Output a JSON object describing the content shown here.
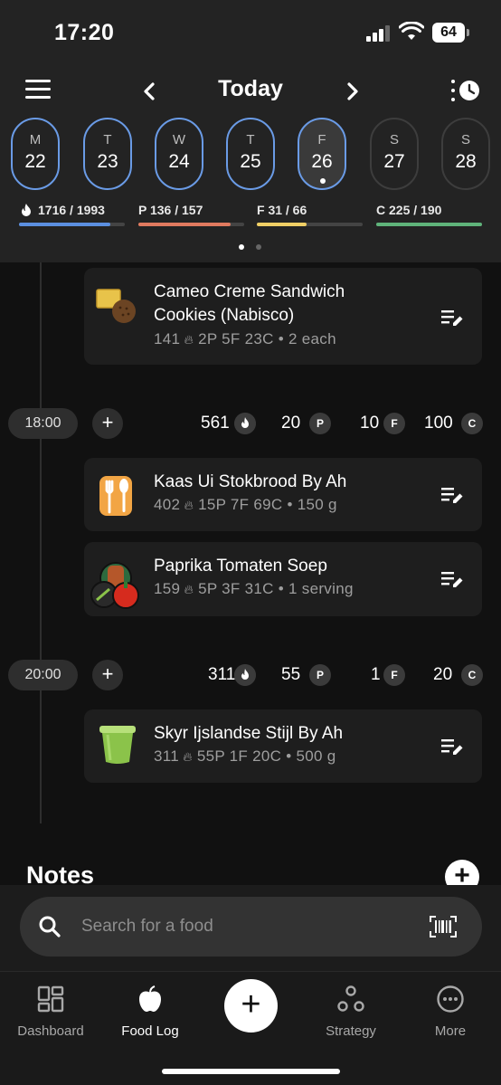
{
  "status_bar": {
    "time": "17:20",
    "battery": "64"
  },
  "header": {
    "title": "Today"
  },
  "days": [
    {
      "letter": "M",
      "number": "22"
    },
    {
      "letter": "T",
      "number": "23"
    },
    {
      "letter": "W",
      "number": "24"
    },
    {
      "letter": "T",
      "number": "25"
    },
    {
      "letter": "F",
      "number": "26"
    },
    {
      "letter": "S",
      "number": "27"
    },
    {
      "letter": "S",
      "number": "28"
    }
  ],
  "macros": {
    "calories": {
      "label": "1716 / 1993",
      "progress": 0.86,
      "color": "#5b8fe0"
    },
    "protein": {
      "label": "P 136 / 157",
      "progress": 0.87,
      "color": "#e07a5f"
    },
    "fat": {
      "label": "F 31 / 66",
      "progress": 0.47,
      "color": "#f0cf65"
    },
    "carbs": {
      "label": "C 225 / 190",
      "progress": 1.0,
      "color": "#5fb37a"
    }
  },
  "entries": {
    "cameo": {
      "name_line1": "Cameo Creme Sandwich",
      "name_line2": "Cookies (Nabisco)",
      "kcal": "141",
      "meta": "2P   5F   23C  •  2 each"
    },
    "kaas": {
      "name": "Kaas Ui Stokbrood By Ah",
      "kcal": "402",
      "meta": "15P   7F   69C  •  150 g"
    },
    "paprika": {
      "name": "Paprika Tomaten Soep",
      "kcal": "159",
      "meta": "5P   3F   31C  •  1 serving"
    },
    "skyr": {
      "name": "Skyr Ijslandse Stijl By Ah",
      "kcal": "311",
      "meta": "55P   1F   20C  •  500 g"
    }
  },
  "meals": {
    "m1800": {
      "time": "18:00",
      "kcal": "561",
      "protein": "20",
      "fat": "10",
      "carbs": "100"
    },
    "m2000": {
      "time": "20:00",
      "kcal": "311",
      "protein": "55",
      "fat": "1",
      "carbs": "20"
    }
  },
  "badges": {
    "p": "P",
    "f": "F",
    "c": "C"
  },
  "notes": {
    "title": "Notes"
  },
  "search": {
    "placeholder": "Search for a food"
  },
  "tabs": {
    "dashboard": "Dashboard",
    "foodlog": "Food Log",
    "strategy": "Strategy",
    "more": "More"
  }
}
